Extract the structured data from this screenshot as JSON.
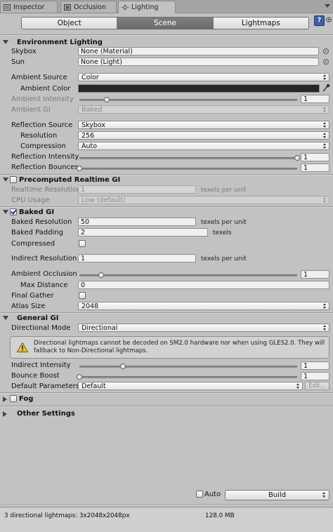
{
  "tabs": [
    {
      "label": "Inspector",
      "icon": "inspector-icon"
    },
    {
      "label": "Occlusion",
      "icon": "occlusion-icon"
    },
    {
      "label": "Lighting",
      "icon": "lighting-icon",
      "active": true
    }
  ],
  "toolbar": {
    "object": "Object",
    "scene": "Scene",
    "lightmaps": "Lightmaps",
    "active": "Scene"
  },
  "environment": {
    "title": "Environment Lighting",
    "skybox_label": "Skybox",
    "skybox_value": "None (Material)",
    "sun_label": "Sun",
    "sun_value": "None (Light)",
    "ambient_source_label": "Ambient Source",
    "ambient_source_value": "Color",
    "ambient_color_label": "Ambient Color",
    "ambient_color_value": "#262626",
    "ambient_intensity_label": "Ambient Intensity",
    "ambient_intensity_value": "1",
    "ambient_gi_label": "Ambient GI",
    "ambient_gi_value": "Baked",
    "reflection_source_label": "Reflection Source",
    "reflection_source_value": "Skybox",
    "resolution_label": "Resolution",
    "resolution_value": "256",
    "compression_label": "Compression",
    "compression_value": "Auto",
    "reflection_intensity_label": "Reflection Intensity",
    "reflection_intensity_value": "1",
    "reflection_bounces_label": "Reflection Bounces",
    "reflection_bounces_value": "1"
  },
  "precomputed": {
    "title": "Precomputed Realtime GI",
    "enabled": false,
    "realtime_resolution_label": "Realtime Resolution",
    "realtime_resolution_value": "1",
    "texels_per_unit": "texels per unit",
    "cpu_usage_label": "CPU Usage",
    "cpu_usage_value": "Low (default)"
  },
  "baked": {
    "title": "Baked GI",
    "enabled": true,
    "baked_resolution_label": "Baked Resolution",
    "baked_resolution_value": "50",
    "texels_per_unit": "texels per unit",
    "baked_padding_label": "Baked Padding",
    "baked_padding_value": "2",
    "texels": "texels",
    "compressed_label": "Compressed",
    "compressed": false,
    "indirect_resolution_label": "Indirect Resolution",
    "indirect_resolution_value": "1",
    "ambient_occlusion_label": "Ambient Occlusion",
    "ambient_occlusion_value": "1",
    "max_distance_label": "Max Distance",
    "max_distance_value": "0",
    "final_gather_label": "Final Gather",
    "final_gather": false,
    "atlas_size_label": "Atlas Size",
    "atlas_size_value": "2048"
  },
  "general": {
    "title": "General GI",
    "directional_mode_label": "Directional Mode",
    "directional_mode_value": "Directional",
    "warning": "Directional lightmaps cannot be decoded on SM2.0 hardware nor when using GLES2.0. They will fallback to Non-Directional lightmaps.",
    "indirect_intensity_label": "Indirect Intensity",
    "indirect_intensity_value": "1",
    "bounce_boost_label": "Bounce Boost",
    "bounce_boost_value": "1",
    "default_parameters_label": "Default Parameters",
    "default_parameters_value": "Default",
    "edit_label": "Edit..."
  },
  "fog": {
    "title": "Fog",
    "enabled": false
  },
  "other": {
    "title": "Other Settings"
  },
  "build": {
    "auto_label": "Auto",
    "auto": false,
    "build_label": "Build"
  },
  "status": {
    "lightmaps": "3 directional lightmaps: 3x2048x2048px",
    "size": "128.0 MB"
  },
  "sliders": {
    "ambient_intensity": 0.125,
    "reflection_intensity": 1.0,
    "reflection_bounces": 0.0,
    "ambient_occlusion": 0.1,
    "indirect_intensity": 0.2,
    "bounce_boost": 0.0
  }
}
